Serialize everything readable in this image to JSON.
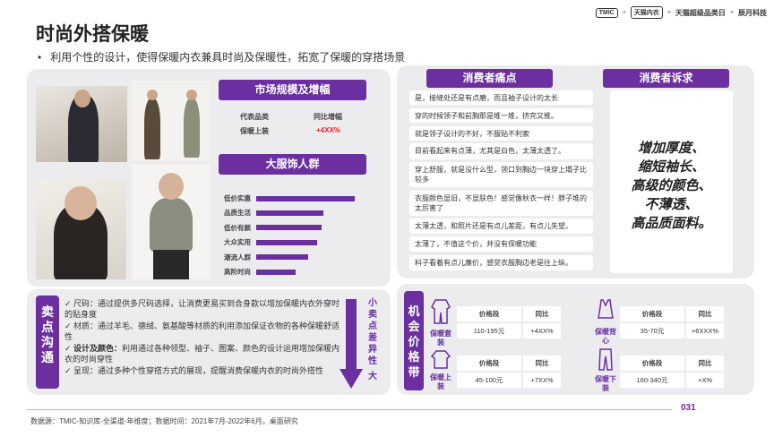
{
  "header": {
    "title": "时尚外搭保暖",
    "subtitle": "利用个性的设计，使得保暖内衣兼具时尚及保暖性，拓宽了保暖的穿搭场景",
    "logos": [
      "TMIC",
      "天猫内衣",
      "天猫超级品类日",
      "辰月科技"
    ],
    "logo_separator": "×"
  },
  "market": {
    "heading": "市场规模及增幅",
    "col1_header": "代表品类",
    "col2_header": "同比增幅",
    "row_category": "保暖上装",
    "row_growth": "+4XX%"
  },
  "crowd": {
    "heading": "大服饰人群",
    "groups": [
      {
        "label": "低价实惠",
        "value": 1.0
      },
      {
        "label": "品质生活",
        "value": 0.68
      },
      {
        "label": "低价有颜",
        "value": 0.66
      },
      {
        "label": "大众实用",
        "value": 0.62
      },
      {
        "label": "潮流人群",
        "value": 0.53
      },
      {
        "label": "高阶时尚",
        "value": 0.4
      }
    ]
  },
  "pain_points": {
    "heading": "消费者痛点",
    "items": [
      "是，接缝处还是有点磨，而且袖子设计的太长",
      "穿的时候领子和前胸那是堆一堆，挤完又推。",
      "就是领子设计的不好，不服贴不利索",
      "目前看起来有点薄，尤其是白色，太薄太透了。",
      "穿上舒服，就是没什么型，领口到胸边一块穿上塌子比较多",
      "衣服颜色显旧，不显肤色！感觉像秋衣一样！脖子堆的太厉害了",
      "太薄太透，和照片还是有点儿差距，有点儿失望。",
      "太薄了，不值这个价，并没有保暖功能",
      "料子看着有点儿廉价，感觉衣服胸边老是往上纵。"
    ]
  },
  "appeals": {
    "heading": "消费者诉求",
    "lines": [
      "增加厚度、",
      "缩短袖长、",
      "高级的颜色、",
      "不薄透、",
      "高品质面料。"
    ]
  },
  "selling_points": {
    "label_chars": [
      "卖",
      "点",
      "沟",
      "通"
    ],
    "items": [
      {
        "title": "尺码：",
        "text": "通过提供多尺码选择，让消费更易买到合身款以增加保暖内衣外穿时的贴身度"
      },
      {
        "title": "材质：",
        "text": "通过羊毛、德绒、氨基酸等材质的利用添加保证衣物的各种保暖舒适性"
      },
      {
        "title": "设计及颜色：",
        "text": "利用通过各种领型、袖子、图案、颜色的设计运用增加保暖内衣的时尚穿性"
      },
      {
        "title": "呈现：",
        "text": "通过多种个性穿搭方式的展现，提醒消费保暖内衣的时尚外搭性"
      }
    ],
    "scale_chars": [
      "小",
      "卖",
      "点",
      "差",
      "异",
      "性",
      "大"
    ]
  },
  "price": {
    "label_chars": [
      "机",
      "会",
      "价",
      "格",
      "带"
    ],
    "col_price": "价格段",
    "col_yoy": "同比",
    "items": [
      {
        "category": "保暖套装",
        "price": "110-195元",
        "yoy": "+4XX%"
      },
      {
        "category": "保暖上装",
        "price": "45-100元",
        "yoy": "+7XX%"
      },
      {
        "category": "保暖背心",
        "price": "35-70元",
        "yoy": "+6XXX%"
      },
      {
        "category": "保暖下装",
        "price": "160-340元",
        "yoy": "+X%"
      }
    ]
  },
  "footer": {
    "source": "数据源：TMIC-知识库-全渠道-年维度；数据时间：2021年7月-2022年6月。桌面研究",
    "page": "031"
  },
  "colors": {
    "accent": "#6b2fa0",
    "panel": "#ececef",
    "growth": "#e0252f"
  }
}
